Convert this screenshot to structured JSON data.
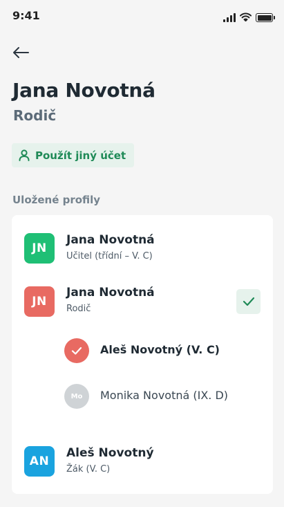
{
  "status_bar": {
    "time": "9:41",
    "icons": [
      "signal-icon",
      "wifi-icon",
      "battery-icon"
    ]
  },
  "header": {
    "back_icon": "arrow-left-icon",
    "user_name": "Jana Novotná",
    "user_role": "Rodič"
  },
  "switch_account": {
    "icon": "user-icon",
    "label": "Použít jiný účet"
  },
  "section_title": "Uložené profily",
  "profiles": [
    {
      "initials": "JN",
      "name": "Jana Novotná",
      "subtitle": "Učitel (třídní – V. C)",
      "avatar_color": "#1fbf75",
      "selected": false
    },
    {
      "initials": "JN",
      "name": "Jana Novotná",
      "subtitle": "Rodič",
      "avatar_color": "#e86a62",
      "selected": true,
      "children": [
        {
          "initials": "",
          "name": "Aleš Novotný (V. C)",
          "selected": true,
          "color": "#e86a62"
        },
        {
          "initials": "Mo",
          "name": "Monika Novotná (IX. D)",
          "selected": false,
          "color": "#cfd3d6"
        }
      ]
    },
    {
      "initials": "AN",
      "name": "Aleš Novotný",
      "subtitle": "Žák (V. C)",
      "avatar_color": "#1aa3df",
      "selected": false
    }
  ],
  "colors": {
    "accent_green": "#1f8a57",
    "accent_green_bg": "#e6f2ec",
    "background": "#f5f5f5"
  }
}
